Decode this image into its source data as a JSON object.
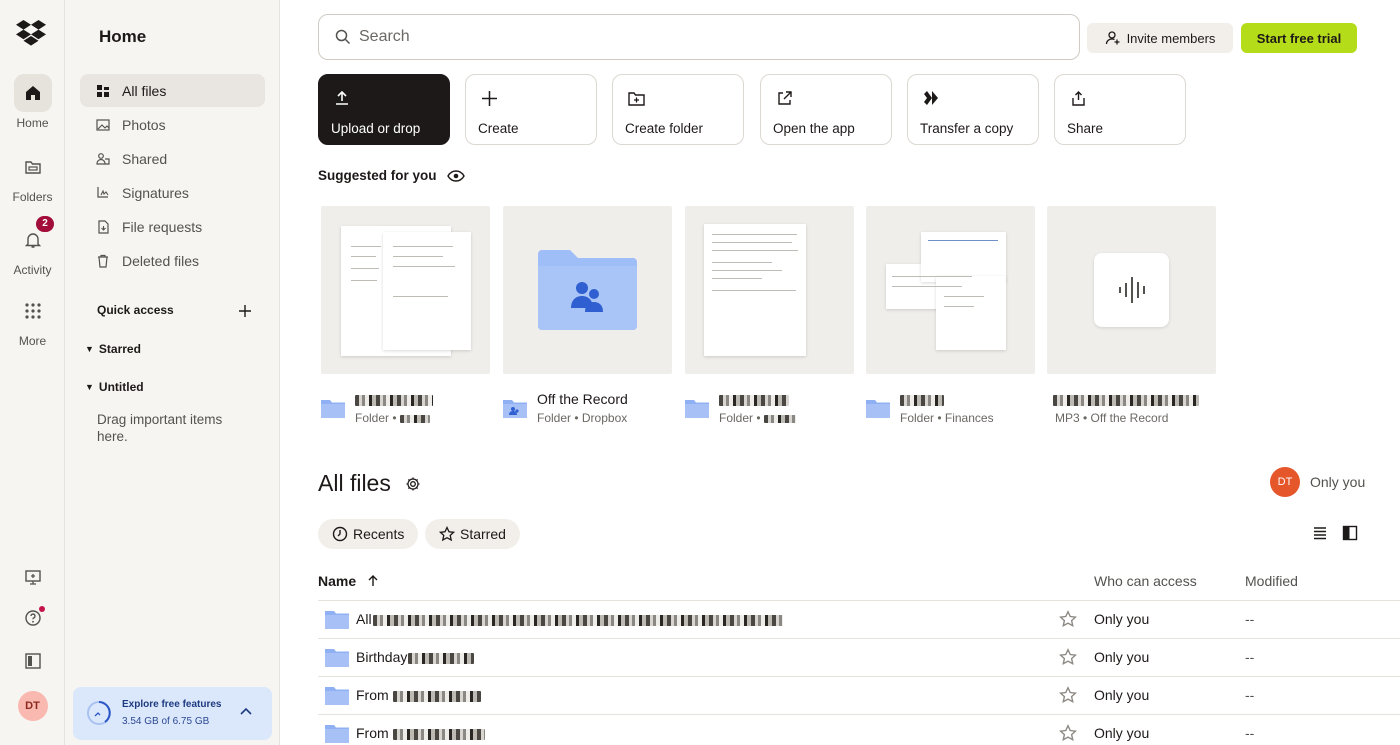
{
  "rail": {
    "items": [
      {
        "label": "Home",
        "icon": "home-icon"
      },
      {
        "label": "Folders",
        "icon": "folder-icon"
      },
      {
        "label": "Activity",
        "icon": "bell-icon",
        "badge": "2"
      },
      {
        "label": "More",
        "icon": "grid-icon"
      }
    ],
    "avatar": "DT"
  },
  "sidebar": {
    "title": "Home",
    "items": [
      {
        "label": "All files",
        "icon": "all-files-icon",
        "active": true
      },
      {
        "label": "Photos",
        "icon": "photo-icon"
      },
      {
        "label": "Shared",
        "icon": "shared-icon"
      },
      {
        "label": "Signatures",
        "icon": "signature-icon"
      },
      {
        "label": "File requests",
        "icon": "file-request-icon"
      },
      {
        "label": "Deleted files",
        "icon": "trash-icon"
      }
    ],
    "quick_access": "Quick access",
    "starred": "Starred",
    "untitled": "Untitled",
    "drag_hint": "Drag important items here.",
    "explore": {
      "title": "Explore free features",
      "usage": "3.54 GB of 6.75 GB"
    }
  },
  "header": {
    "search_placeholder": "Search",
    "invite": "Invite members",
    "trial": "Start free trial",
    "trial_color": "#b4dc19"
  },
  "actions": [
    {
      "label": "Upload or drop",
      "icon": "upload-icon"
    },
    {
      "label": "Create",
      "icon": "plus-icon"
    },
    {
      "label": "Create folder",
      "icon": "create-folder-icon"
    },
    {
      "label": "Open the app",
      "icon": "external-link-icon"
    },
    {
      "label": "Transfer a copy",
      "icon": "transfer-icon"
    },
    {
      "label": "Share",
      "icon": "share-icon"
    }
  ],
  "suggested": {
    "title": "Suggested for you",
    "cards": [
      {
        "name": "",
        "sub": "Folder • ",
        "blurred": true
      },
      {
        "name": "Off the Record",
        "sub": "Folder • Dropbox",
        "blurred": false
      },
      {
        "name": "",
        "sub": "Folder • ",
        "blurred": true
      },
      {
        "name": "",
        "sub": "Folder • Finances",
        "blurred": true
      },
      {
        "name": "",
        "sub": "MP3 • Off the Record",
        "blurred": true
      }
    ]
  },
  "all_files": {
    "title": "All files",
    "owner_avatar": "DT",
    "owner_label": "Only you",
    "filters": [
      "Recents",
      "Starred"
    ],
    "columns": {
      "name": "Name",
      "access": "Who can access",
      "modified": "Modified"
    },
    "rows": [
      {
        "name": "All",
        "access": "Only you",
        "modified": "--"
      },
      {
        "name": "Birthday",
        "access": "Only you",
        "modified": "--"
      },
      {
        "name": "From",
        "access": "Only you",
        "modified": "--"
      },
      {
        "name": "From",
        "access": "Only you",
        "modified": "--"
      }
    ]
  }
}
